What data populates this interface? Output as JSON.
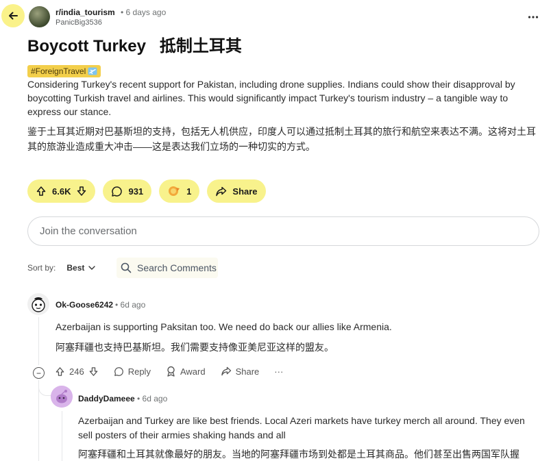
{
  "header": {
    "subreddit": "r/india_tourism",
    "time": "• 6 days ago",
    "author": "PanicBig3536",
    "more_icon": "three-dots-icon"
  },
  "post": {
    "title": "Boycott Turkey   抵制土耳其",
    "flair": "#ForeignTravel",
    "flair_icon": "airplane-icon",
    "body_en": "Considering Turkey's recent support for Pakistan, including drone supplies. Indians could show their disapproval by boycotting Turkish travel and airlines. This would significantly impact Turkey's tourism industry – a tangible way to express our stance.",
    "body_zh": "鉴于土耳其近期对巴基斯坦的支持，包括无人机供应，印度人可以通过抵制土耳其的旅行和航空来表达不满。这将对土耳其的旅游业造成重大冲击——这是表达我们立场的一种切实的方式。"
  },
  "actions": {
    "votes": "6.6K",
    "comments": "931",
    "awards": "1",
    "share": "Share"
  },
  "composer": {
    "placeholder": "Join the conversation"
  },
  "sort": {
    "label": "Sort by:",
    "value": "Best",
    "search_label": "Search Comments"
  },
  "comments": [
    {
      "author": "Ok-Goose6242",
      "time": "• 6d ago",
      "text_en": "Azerbaijan is supporting Paksitan too. We need do back our allies like Armenia.",
      "text_zh": "阿塞拜疆也支持巴基斯坦。我们需要支持像亚美尼亚这样的盟友。",
      "votes": "246",
      "reply": "Reply",
      "award": "Award",
      "share": "Share",
      "collapse": "−",
      "more": "···"
    },
    {
      "author": "DaddyDameee",
      "time": "• 6d ago",
      "text_en": "Azerbaijan and Turkey are like best friends. Local Azeri markets have turkey merch all around. They even sell posters of their armies shaking hands and all",
      "text_zh": "阿塞拜疆和土耳其就像最好的朋友。当地的阿塞拜疆市场到处都是土耳其商品。他们甚至出售两国军队握"
    }
  ],
  "colors": {
    "accent_yellow": "#f8f28c",
    "flair_bg": "#f3cf4b",
    "border": "#d5d7da"
  }
}
